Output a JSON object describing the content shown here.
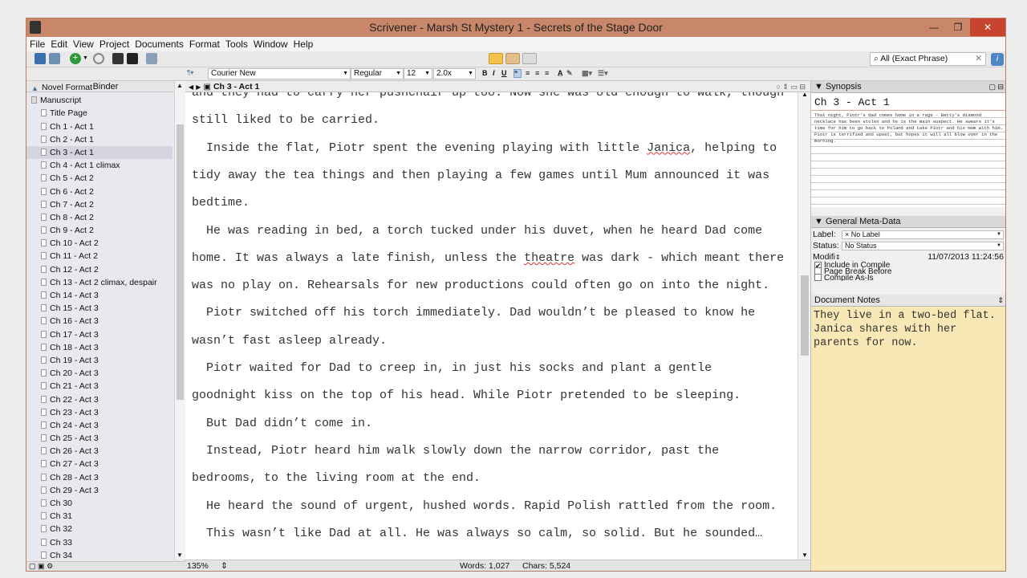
{
  "window": {
    "title": "Scrivener - Marsh St Mystery 1 - Secrets of the Stage Door"
  },
  "menu": [
    "File",
    "Edit",
    "View",
    "Project",
    "Documents",
    "Format",
    "Tools",
    "Window",
    "Help"
  ],
  "search": {
    "value": "All (Exact Phrase)"
  },
  "format_bar": {
    "font": "Courier New",
    "style": "Regular",
    "size": "12",
    "spacing": "2.0x",
    "bold": "B",
    "italic": "I",
    "underline": "U"
  },
  "binder": {
    "header": "Binder",
    "items": [
      "Novel Format",
      "Manuscript",
      "Title Page",
      "Ch 1 - Act 1",
      "Ch 2 - Act 1",
      "Ch 3 - Act 1",
      "Ch 4 - Act 1 climax",
      "Ch 5 - Act 2",
      "Ch 6 - Act 2",
      "Ch 7 - Act 2",
      "Ch 8 - Act 2",
      "Ch 9 - Act 2",
      "Ch 10 - Act 2",
      "Ch 11 - Act 2",
      "Ch 12 - Act 2",
      "Ch 13 - Act 2 climax, despair",
      "Ch 14 - Act 3",
      "Ch 15 - Act 3",
      "Ch 16 - Act 3",
      "Ch 17 - Act 3",
      "Ch 18 - Act 3",
      "Ch 19 - Act 3",
      "Ch 20 - Act 3",
      "Ch 21 - Act 3",
      "Ch 22 - Act 3",
      "Ch 23 - Act 3",
      "Ch 24 - Act 3",
      "Ch 25 - Act 3",
      "Ch 26 - Act 3",
      "Ch 27 - Act 3",
      "Ch 28 - Act 3",
      "Ch 29 - Act 3",
      "Ch 30",
      "Ch 31",
      "Ch 32",
      "Ch 33",
      "Ch 34"
    ],
    "selected": "Ch 3 - Act 1"
  },
  "editor": {
    "doc_title": "Ch 3 - Act 1",
    "lines": [
      "and they had to carry her pushchair up too. Now she was old enough to walk, though",
      "still liked to be carried.",
      "  Inside the flat, Piotr spent the evening playing with little Janica, helping to",
      "tidy away the tea things and then playing a few games until Mum announced it was",
      "bedtime.",
      "  He was reading in bed, a torch tucked under his duvet, when he heard Dad come",
      "home. It was always a late finish, unless the theatre was dark - which meant there",
      "was no play on. Rehearsals for new productions could often go on into the night.",
      "  Piotr switched off his torch immediately. Dad wouldn’t be pleased to know he",
      "wasn’t fast asleep already.",
      "  Piotr waited for Dad to creep in, in just his socks and plant a gentle",
      "goodnight kiss on the top of his head. While Piotr pretended to be sleeping.",
      "  But Dad didn’t come in.",
      "  Instead, Piotr heard him walk slowly down the narrow corridor, past the",
      "bedrooms, to the living room at the end.",
      "  He heard the sound of urgent, hushed words. Rapid Polish rattled from the room.",
      "  This wasn’t like Dad at all. He was always so calm, so solid. But he sounded…"
    ],
    "zoom": "135%",
    "words": "Words: 1,027",
    "chars": "Chars: 5,524"
  },
  "inspector": {
    "synopsis_header": "Synopsis",
    "synopsis_title": "Ch 3 - Act 1",
    "synopsis_text": "That night, Piotr's dad comes home in a rage - Betty's diamond necklace has been stolen and he is the main suspect. He swears it's time for him to go back to Poland and take Piotr and his mum with him. Piotr is terrified and upset, but hopes it will all blow over in the morning.",
    "meta_header": "General Meta-Data",
    "label_key": "Label:",
    "label_value": "No Label",
    "status_key": "Status:",
    "status_value": "No Status",
    "modified_key": "Modifi",
    "modified_value": "11/07/2013 11:24:56",
    "include_in_compile": "Include in Compile",
    "page_break_before": "Page Break Before",
    "compile_as_is": "Compile As-Is",
    "notes_header": "Document Notes",
    "notes_text": "They live in a two-bed flat. Janica shares with her parents for now."
  }
}
